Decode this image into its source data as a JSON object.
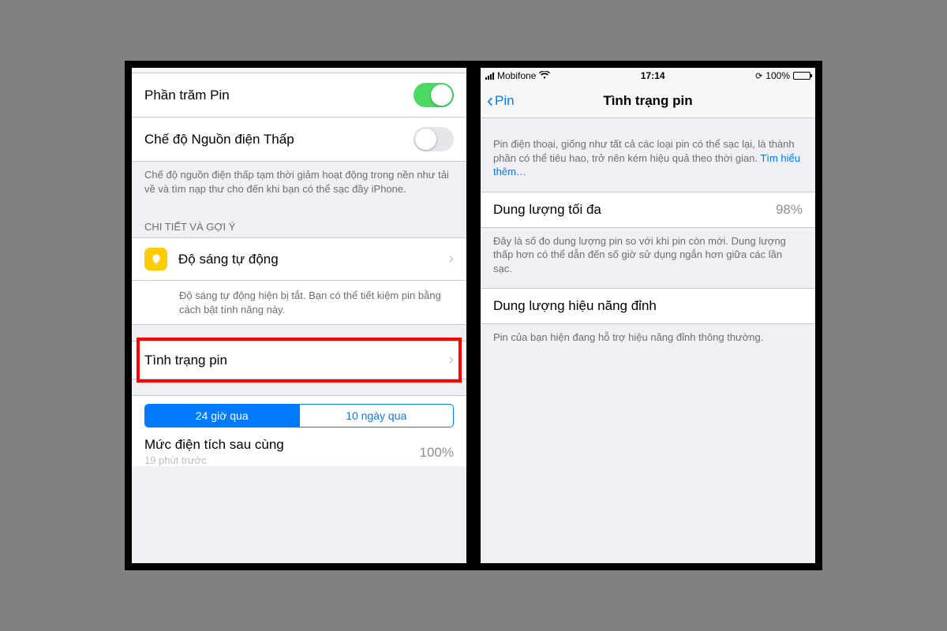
{
  "left": {
    "battery_percent_row": {
      "label": "Phần trăm Pin",
      "on": true
    },
    "low_power_row": {
      "label": "Chế độ Nguồn điện Thấp",
      "on": false
    },
    "low_power_footer": "Chế độ nguồn điện thấp tạm thời giảm hoạt động trong nền như tải về và tìm nạp thư cho đến khi bạn có thể sạc đầy iPhone.",
    "insights_header": "CHI TIẾT VÀ GỢI Ý",
    "auto_brightness": {
      "label": "Độ sáng tự động",
      "sub": "Độ sáng tự động hiện bị tắt. Bạn có thể tiết kiệm pin bằng cách bật tính năng này."
    },
    "battery_health": {
      "label": "Tình trạng pin"
    },
    "segments": {
      "left": "24 giờ qua",
      "right": "10 ngày qua"
    },
    "last_charge": {
      "title": "Mức điện tích sau cùng",
      "sub": "19 phút trước",
      "value": "100%"
    }
  },
  "right": {
    "status": {
      "carrier": "Mobifone",
      "time": "17:14",
      "battery_text": "100%"
    },
    "nav": {
      "back": "Pin",
      "title": "Tình trạng pin"
    },
    "intro_text": "Pin điện thoại, giống như tất cả các loại pin có thể sạc lại, là thành phần có thể tiêu hao, trở nên kém hiệu quả theo thời gian. ",
    "intro_link": "Tìm hiểu thêm…",
    "max_capacity": {
      "label": "Dung lượng tối đa",
      "value": "98%"
    },
    "max_capacity_footer": "Đây là số đo dung lượng pin so với khi pin còn mới. Dung lượng thấp hơn có thể dẫn đến số giờ sử dụng ngắn hơn giữa các lần sạc.",
    "peak_perf": {
      "label": "Dung lượng hiệu năng đỉnh"
    },
    "peak_perf_footer": "Pin của bạn hiện đang hỗ trợ hiệu năng đỉnh thông thường."
  }
}
